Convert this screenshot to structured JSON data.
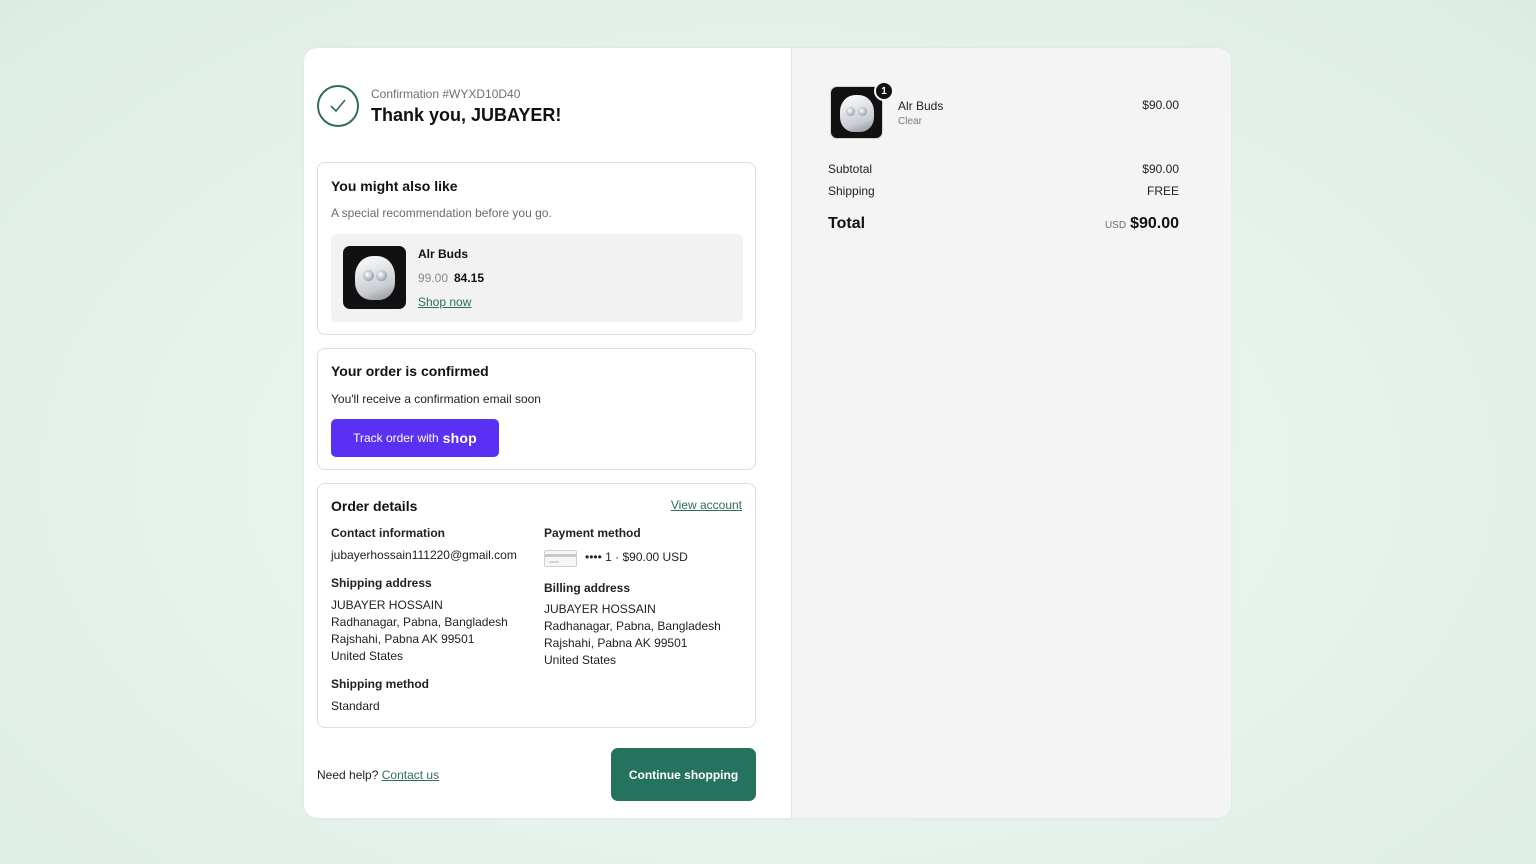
{
  "header": {
    "confirmation": "Confirmation #WYXD10D40",
    "thanks": "Thank you, JUBAYER!"
  },
  "recommendation": {
    "title": "You might also like",
    "subtitle": "A special recommendation before you go.",
    "product_name": "Alr Buds",
    "old_price": "99.00",
    "new_price": "84.15",
    "link": "Shop now"
  },
  "confirmed": {
    "title": "Your order is confirmed",
    "subtitle": "You'll receive a confirmation email soon",
    "track_label": "Track order with",
    "track_brand": "shop"
  },
  "details": {
    "title": "Order details",
    "view_account": "View account",
    "contact_label": "Contact information",
    "contact_email": "jubayerhossain111220@gmail.com",
    "shipping_label": "Shipping address",
    "shipping_lines": [
      "JUBAYER HOSSAIN",
      "Radhanagar, Pabna, Bangladesh",
      "Rajshahi, Pabna AK 99501",
      "United States"
    ],
    "shipping_method_label": "Shipping method",
    "shipping_method": "Standard",
    "payment_label": "Payment method",
    "payment_value": "•••• 1 · $90.00 USD",
    "billing_label": "Billing address",
    "billing_lines": [
      "JUBAYER HOSSAIN",
      "Radhanagar, Pabna, Bangladesh",
      "Rajshahi, Pabna AK 99501",
      "United States"
    ]
  },
  "footer": {
    "help_text": "Need help?",
    "contact_link": "Contact us",
    "continue_label": "Continue shopping"
  },
  "summary": {
    "item_name": "Alr Buds",
    "item_variant": "Clear",
    "item_qty": "1",
    "item_price": "$90.00",
    "subtotal_label": "Subtotal",
    "subtotal_value": "$90.00",
    "shipping_label": "Shipping",
    "shipping_value": "FREE",
    "total_label": "Total",
    "total_currency": "USD",
    "total_value": "$90.00"
  },
  "colors": {
    "accent_green": "#25735f",
    "shop_purple": "#5a31f4"
  }
}
